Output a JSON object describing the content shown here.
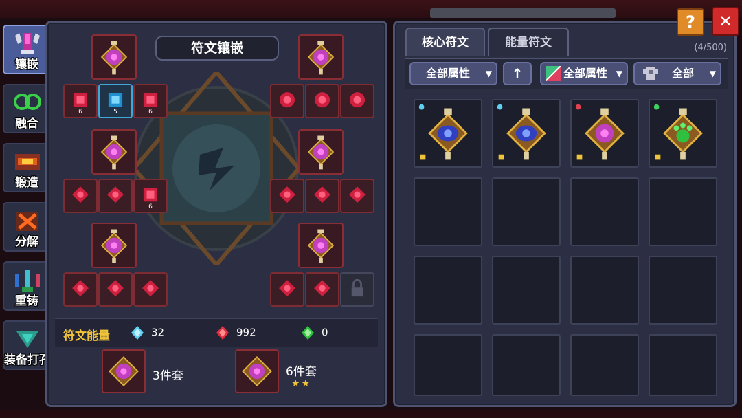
{
  "nav": {
    "items": [
      {
        "label": "镶嵌",
        "icon": "inlay-icon",
        "active": true
      },
      {
        "label": "融合",
        "icon": "fusion-icon",
        "active": false
      },
      {
        "label": "锻造",
        "icon": "forge-icon",
        "active": false
      },
      {
        "label": "分解",
        "icon": "decompose-icon",
        "active": false
      },
      {
        "label": "重铸",
        "icon": "recast-icon",
        "active": false
      },
      {
        "label": "装备打孔",
        "icon": "punch-icon",
        "active": false
      }
    ]
  },
  "left_panel": {
    "title": "符文镶嵌",
    "socket_numbers": {
      "n1": "6",
      "n2": "5",
      "n3": "6",
      "n4": "6"
    },
    "energy": {
      "label": "符文能量",
      "blue": "32",
      "red": "992",
      "green": "0"
    },
    "sets": [
      {
        "label": "3件套"
      },
      {
        "label": "6件套",
        "stars": "★★"
      }
    ]
  },
  "right_panel": {
    "tabs": [
      {
        "label": "核心符文",
        "active": true
      },
      {
        "label": "能量符文",
        "active": false
      }
    ],
    "count": "(4/500)",
    "filters": {
      "attr1": "全部属性",
      "attr2": "全部属性",
      "all": "全部"
    }
  },
  "buttons": {
    "help": "?",
    "close": "✕"
  },
  "colors": {
    "panel": "#2c2f43",
    "accent_gold": "#f0c43a",
    "close_red": "#d02a2a",
    "help_orange": "#e08a28"
  }
}
